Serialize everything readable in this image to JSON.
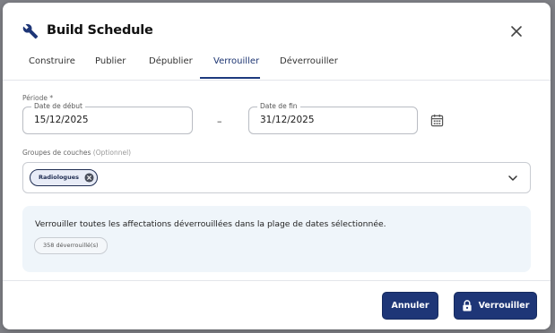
{
  "dialog": {
    "title": "Build Schedule",
    "icon": "wrench-icon",
    "close_icon": "close-icon"
  },
  "tabs": [
    {
      "label": "Construire",
      "active": false
    },
    {
      "label": "Publier",
      "active": false
    },
    {
      "label": "Dépublier",
      "active": false
    },
    {
      "label": "Verrouiller",
      "active": true
    },
    {
      "label": "Déverrouiller",
      "active": false
    }
  ],
  "period": {
    "label": "Période *",
    "start_label": "Date de début",
    "start_value": "15/12/2025",
    "separator": "–",
    "end_label": "Date de fin",
    "end_value": "31/12/2025",
    "calendar_icon": "calendar-icon"
  },
  "layer_groups": {
    "label": "Groupes de couches",
    "optional": "(Optionnel)",
    "chips": [
      {
        "label": "Radiologues"
      }
    ]
  },
  "info": {
    "text": "Verrouiller toutes les affectations déverrouillées dans la plage de dates sélectionnée.",
    "badge": "358 déverrouillé(s)"
  },
  "footer": {
    "cancel_label": "Annuler",
    "lock_label": "Verrouiller"
  },
  "colors": {
    "primary": "#1e3677",
    "info_background": "#eff5fa"
  }
}
